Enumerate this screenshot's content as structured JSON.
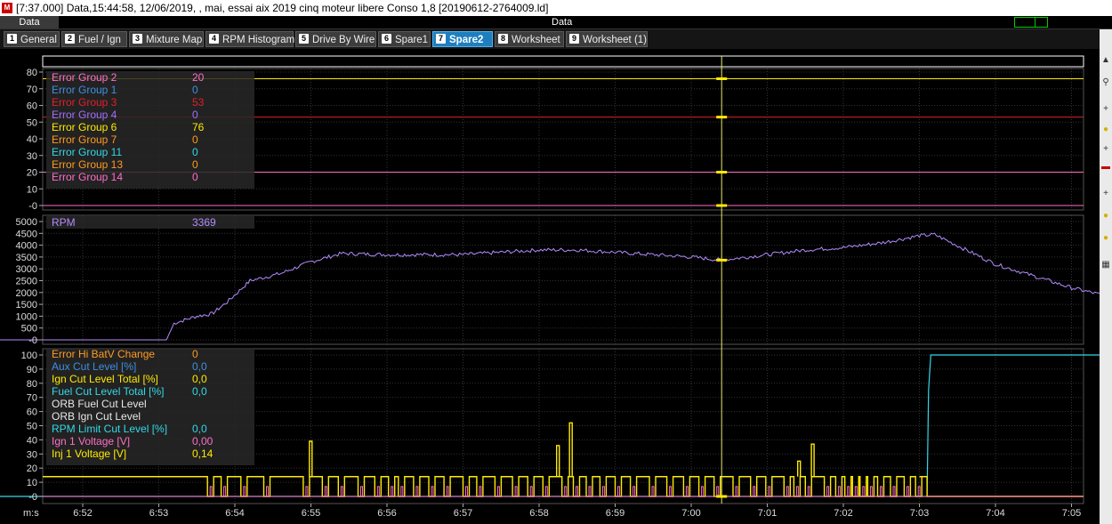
{
  "window": {
    "title": "[7:37.000] Data,15:44:58, 12/06/2019, , mai, essai aix 2019 cinq moteur libere Conso 1,8 [20190612-2764009.ld]",
    "app_icon": "M",
    "data_tab": "Data",
    "data_center": "Data"
  },
  "tabs": [
    {
      "num": "1",
      "label": "General",
      "active": false
    },
    {
      "num": "2",
      "label": "Fuel / Ign",
      "active": false
    },
    {
      "num": "3",
      "label": "Mixture Map",
      "active": false
    },
    {
      "num": "4",
      "label": "RPM Histogram",
      "active": false
    },
    {
      "num": "5",
      "label": "Drive By Wire",
      "active": false
    },
    {
      "num": "6",
      "label": "Spare1",
      "active": false
    },
    {
      "num": "7",
      "label": "Spare2",
      "active": true
    },
    {
      "num": "8",
      "label": "Worksheet",
      "active": false
    },
    {
      "num": "9",
      "label": "Worksheet (1)",
      "active": false
    }
  ],
  "colors": {
    "background": "#000000",
    "grid": "#3a3a3a",
    "cursor": "#e8e870",
    "rpm_line": "#b48cff",
    "yellow": "#ffea00",
    "pink": "#ff6ec7",
    "cyan": "#34d8e8",
    "error_line_red": "#c8102e",
    "error_line_pink": "#ff6ec7",
    "accent_tab": "#1e7fc0"
  },
  "cursor": {
    "time": "7:00.4"
  },
  "x_axis_unit": "m:s",
  "chart_data": [
    {
      "type": "line",
      "name_panel": "errors",
      "yticks": [
        "80",
        "70",
        "60",
        "50",
        "40",
        "30",
        "20",
        "10",
        "-0"
      ],
      "ylim": [
        0,
        80
      ],
      "legend": [
        {
          "name": "Error Group 2",
          "value": "20",
          "color": "#ff6ec7"
        },
        {
          "name": "Error Group 1",
          "value": "0",
          "color": "#3f8fe0"
        },
        {
          "name": "Error Group 3",
          "value": "53",
          "color": "#e0202a"
        },
        {
          "name": "Error Group 4",
          "value": "0",
          "color": "#a070ff"
        },
        {
          "name": "Error Group 6",
          "value": "76",
          "color": "#ffea00"
        },
        {
          "name": "Error Group 7",
          "value": "0",
          "color": "#ff9a20"
        },
        {
          "name": "Error Group 11",
          "value": "0",
          "color": "#34d8e8"
        },
        {
          "name": "Error Group 13",
          "value": "0",
          "color": "#ff9a20"
        },
        {
          "name": "Error Group 14",
          "value": "0",
          "color": "#ff6ec7"
        }
      ],
      "series": [
        {
          "label": "Error Group 6",
          "value": 76,
          "color": "#ffea00"
        },
        {
          "label": "Error Group 3",
          "value": 53,
          "color": "#e0202a"
        },
        {
          "label": "Error Group 2",
          "value": 20,
          "color": "#ff6ec7"
        },
        {
          "label": "Error Group 14",
          "value": 0,
          "color": "#ff6ec7"
        }
      ]
    },
    {
      "type": "line",
      "name_panel": "rpm",
      "yticks": [
        "5000",
        "4500",
        "4000",
        "3500",
        "3000",
        "2500",
        "2000",
        "1500",
        "1000",
        "500",
        "-0"
      ],
      "ylim": [
        0,
        5000
      ],
      "legend": [
        {
          "name": "RPM",
          "value": "3369",
          "color": "#b48cff"
        }
      ],
      "x": [
        "6:50.0",
        "6:53.1",
        "6:53.2",
        "6:53.5",
        "6:53.7",
        "6:53.9",
        "6:54.2",
        "6:54.6",
        "6:55.0",
        "6:55.4",
        "6:56.0",
        "6:57.0",
        "6:58.0",
        "6:58.5",
        "6:59.0",
        "6:59.5",
        "7:00.0",
        "7:00.4",
        "7:01.0",
        "7:01.5",
        "7:02.0",
        "7:02.5",
        "7:03.0",
        "7:03.2",
        "7:04.0",
        "7:05.0",
        "7:05.4"
      ],
      "values": [
        0,
        0,
        700,
        1000,
        1100,
        1600,
        2500,
        2800,
        3300,
        3650,
        3600,
        3600,
        3800,
        3800,
        3700,
        3600,
        3500,
        3369,
        3600,
        3800,
        3900,
        4100,
        4400,
        4450,
        3200,
        2200,
        1900
      ]
    },
    {
      "type": "line",
      "name_panel": "cut_levels",
      "yticks": [
        "100",
        "90",
        "80",
        "70",
        "60",
        "50",
        "40",
        "30",
        "20",
        "10",
        "-0"
      ],
      "ylim": [
        0,
        100
      ],
      "legend": [
        {
          "name": "Error Hi BatV Change",
          "value": "0",
          "color": "#ff9a20"
        },
        {
          "name": "Aux Cut Level [%]",
          "value": "0,0",
          "color": "#3f8fe0"
        },
        {
          "name": "Ign Cut Level Total [%]",
          "value": "0,0",
          "color": "#ffea00"
        },
        {
          "name": "Fuel Cut Level Total [%]",
          "value": "0,0",
          "color": "#34d8e8"
        },
        {
          "name": "ORB Fuel Cut Level",
          "value": "",
          "color": "#e8e8e8"
        },
        {
          "name": "ORB Ign Cut Level",
          "value": "",
          "color": "#e8e8e8"
        },
        {
          "name": "RPM Limit Cut Level [%]",
          "value": "0,0",
          "color": "#34d8e8"
        },
        {
          "name": "Ign 1 Voltage [V]",
          "value": "0,00",
          "color": "#ff6ec7"
        },
        {
          "name": "Inj 1 Voltage [V]",
          "value": "0,14",
          "color": "#ffea00"
        }
      ],
      "series": [
        {
          "label": "Fuel Cut Level Total [%]",
          "color": "#34d8e8",
          "x": [
            "6:50.0",
            "7:03.1",
            "7:03.12",
            "7:03.15",
            "7:05.4"
          ],
          "values": [
            0,
            0,
            75,
            100,
            100
          ]
        },
        {
          "label": "Inj 1 Voltage [V]",
          "color": "#ffea00",
          "baseline": 14
        },
        {
          "label": "Ign 1 Voltage [V]",
          "color": "#ff6ec7",
          "baseline": 0
        }
      ]
    }
  ],
  "xticks": [
    "6:52",
    "6:53",
    "6:54",
    "6:55",
    "6:56",
    "6:57",
    "6:58",
    "6:59",
    "7:00",
    "7:01",
    "7:02",
    "7:03",
    "7:04",
    "7:05"
  ]
}
